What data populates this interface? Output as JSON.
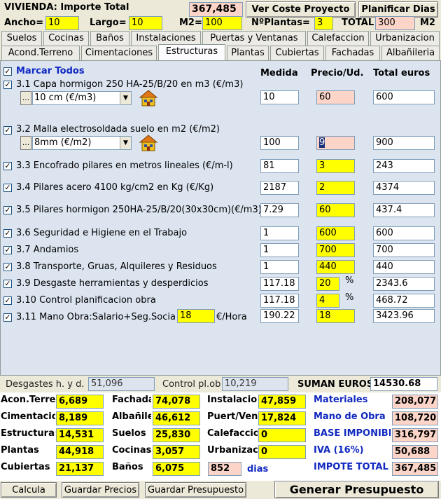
{
  "header": {
    "title": "VIVIENDA: Importe Total",
    "total_value": "367,485",
    "ver_coste_label": "Ver Coste Proyecto",
    "planificar_label": "Planificar Dias",
    "ancho_label": "Ancho=",
    "ancho_value": "10",
    "largo_label": "Largo=",
    "largo_value": "10",
    "m2_label": "M2=",
    "m2_value": "100",
    "nplantas_label": "NºPlantas=",
    "nplantas_value": "3",
    "total_label": "TOTAL",
    "total_m2_value": "300",
    "m2_unit": "M2"
  },
  "tabs_row1": [
    "Suelos",
    "Cocinas",
    "Baños",
    "Instalaciones",
    "Puertas y Ventanas",
    "Calefaccion",
    "Urbanizacion"
  ],
  "tabs_row2": [
    "Acond.Terreno",
    "Cimentaciones",
    "Estructuras",
    "Plantas",
    "Cubiertas",
    "Fachadas",
    "Albañileria"
  ],
  "active_tab": "Estructuras",
  "panel": {
    "marcar_todos": "Marcar Todos",
    "col_medida": "Medida",
    "col_precio": "Precio/Ud.",
    "col_total": "Total euros",
    "items": [
      {
        "label": "3.1 Capa hormigon 250 HA-25/B/20 en m3 (€/m3)",
        "medida": "10",
        "precio": "60",
        "total": "600",
        "dropdown": "10 cm (€/m3)"
      },
      {
        "label": "3.2 Malla electrosoldada suelo en m2 (€/m2)",
        "medida": "100",
        "precio": "9",
        "total": "900",
        "dropdown": "8mm (€/m2)"
      },
      {
        "label": "3.3 Encofrado pilares en metros lineales (€/m-l)",
        "medida": "81",
        "precio": "3",
        "total": "243"
      },
      {
        "label": "3.4 Pilares acero 4100 kg/cm2 en Kg (€/Kg)",
        "medida": "2187",
        "precio": "2",
        "total": "4374"
      },
      {
        "label": "3.5 Pilares hormigon 250HA-25/B/20(30x30cm)(€/m3)",
        "medida": "7.29",
        "precio": "60",
        "total": "437.4"
      },
      {
        "label": "3.6 Seguridad e Higiene en el Trabajo",
        "medida": "1",
        "precio": "600",
        "total": "600"
      },
      {
        "label": "3.7 Andamios",
        "medida": "1",
        "precio": "700",
        "total": "700"
      },
      {
        "label": "3.8 Transporte, Gruas, Alquileres y Residuos",
        "medida": "1",
        "precio": "440",
        "total": "440"
      },
      {
        "label": "3.9 Desgaste herramientas y desperdicios",
        "medida": "117.18",
        "precio": "20",
        "unit": "%",
        "total": "2343.6"
      },
      {
        "label": "3.10 Control planificacion obra",
        "medida": "117.18",
        "precio": "4",
        "unit": "%",
        "total": "468.72"
      },
      {
        "label": "3.11 Mano Obra:Salario+Seg.Social",
        "extra": "18",
        "extra_unit": "€/Hora",
        "medida": "190.22",
        "precio": "18",
        "total": "3423.96"
      }
    ]
  },
  "bottom_bar": {
    "desgastes_label": "Desgastes h. y d.",
    "desgastes_value": "51,096",
    "control_label": "Control pl.ob",
    "control_value": "10,219",
    "suman_label": "SUMAN EUROS",
    "suman_value": "14530.68"
  },
  "summary": {
    "col1": [
      {
        "label": "Acon.Terreno",
        "value": "6,689"
      },
      {
        "label": "Cimentaciones",
        "value": "8,189"
      },
      {
        "label": "Estructuras",
        "value": "14,531"
      },
      {
        "label": "Plantas",
        "value": "44,918"
      },
      {
        "label": "Cubiertas",
        "value": "21,137"
      }
    ],
    "col2": [
      {
        "label": "Fachadas",
        "value": "74,078"
      },
      {
        "label": "Albañileria",
        "value": "46,612"
      },
      {
        "label": "Suelos",
        "value": "25,830"
      },
      {
        "label": "Cocinas",
        "value": "3,057"
      },
      {
        "label": "Baños",
        "value": "6,075"
      }
    ],
    "col3": [
      {
        "label": "Instalaciones",
        "value": "47,859"
      },
      {
        "label": "Puert/Vent",
        "value": "17,824"
      },
      {
        "label": "Calefaccion",
        "value": "0"
      },
      {
        "label": "Urbanizacion",
        "value": "0"
      }
    ],
    "dias_value": "852",
    "dias_label": "dias",
    "col4": [
      {
        "label": "Materiales",
        "value": "208,077"
      },
      {
        "label": "Mano de Obra",
        "value": "108,720"
      },
      {
        "label": "BASE IMPONIBLE",
        "value": "316,797"
      },
      {
        "label": "IVA (16%)",
        "value": "50,688"
      },
      {
        "label": "IMPOTE TOTAL",
        "value": "367,485"
      }
    ]
  },
  "footer": {
    "calcula": "Calcula",
    "guardar_precios": "Guardar Precios",
    "guardar_presupuesto": "Guardar Presupuesto",
    "generar": "Generar Presupuesto"
  },
  "checkmark": "✓",
  "dd_dots": "...",
  "dd_arrow": "▼",
  "colors": {
    "yellow": "#ffff00",
    "pink": "#fcd5c8",
    "panel": "#dbe4ef",
    "blue_text": "#1028c0"
  }
}
